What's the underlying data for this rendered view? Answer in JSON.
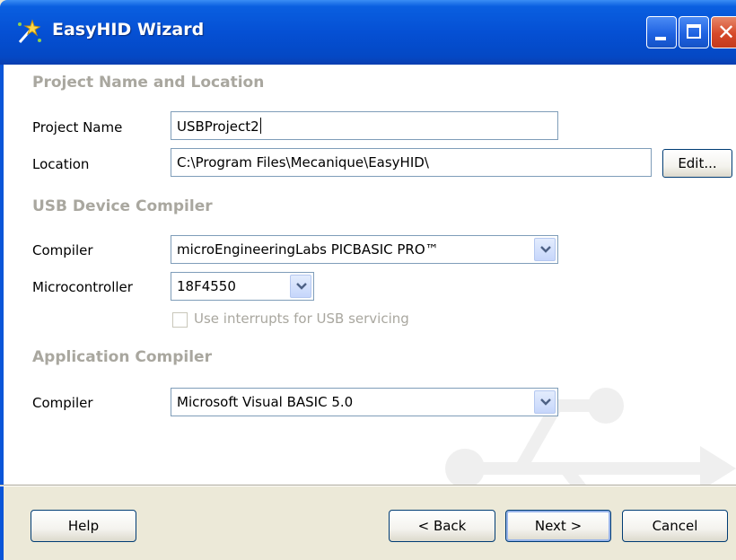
{
  "window": {
    "title": "EasyHID Wizard",
    "title_icon": "wand-sparkle-icon",
    "controls": [
      "minimize-icon",
      "maximize-icon",
      "close-icon"
    ]
  },
  "sections": {
    "project": {
      "heading": "Project Name and Location",
      "project_name_label": "Project Name",
      "project_name_value": "USBProject2",
      "location_label": "Location",
      "location_value": "C:\\Program Files\\Mecanique\\EasyHID\\",
      "edit_button": "Edit..."
    },
    "device": {
      "heading": "USB Device Compiler",
      "compiler_label": "Compiler",
      "compiler_value": "microEngineeringLabs PICBASIC PRO™",
      "micro_label": "Microcontroller",
      "micro_value": "18F4550",
      "interrupts_label": "Use interrupts for USB servicing",
      "interrupts_checked": false,
      "interrupts_enabled": false
    },
    "application": {
      "heading": "Application Compiler",
      "compiler_label": "Compiler",
      "compiler_value": "Microsoft Visual BASIC 5.0"
    }
  },
  "footer": {
    "help": "Help",
    "back": "< Back",
    "next": "Next >",
    "cancel": "Cancel"
  },
  "watermark_icon": "usb-icon",
  "colors": {
    "titlebar": "#0550d4",
    "dialog_bg": "#ece9d8",
    "heading_gray": "#a9a79f",
    "input_border": "#7f9db9",
    "button_border": "#003c74"
  }
}
